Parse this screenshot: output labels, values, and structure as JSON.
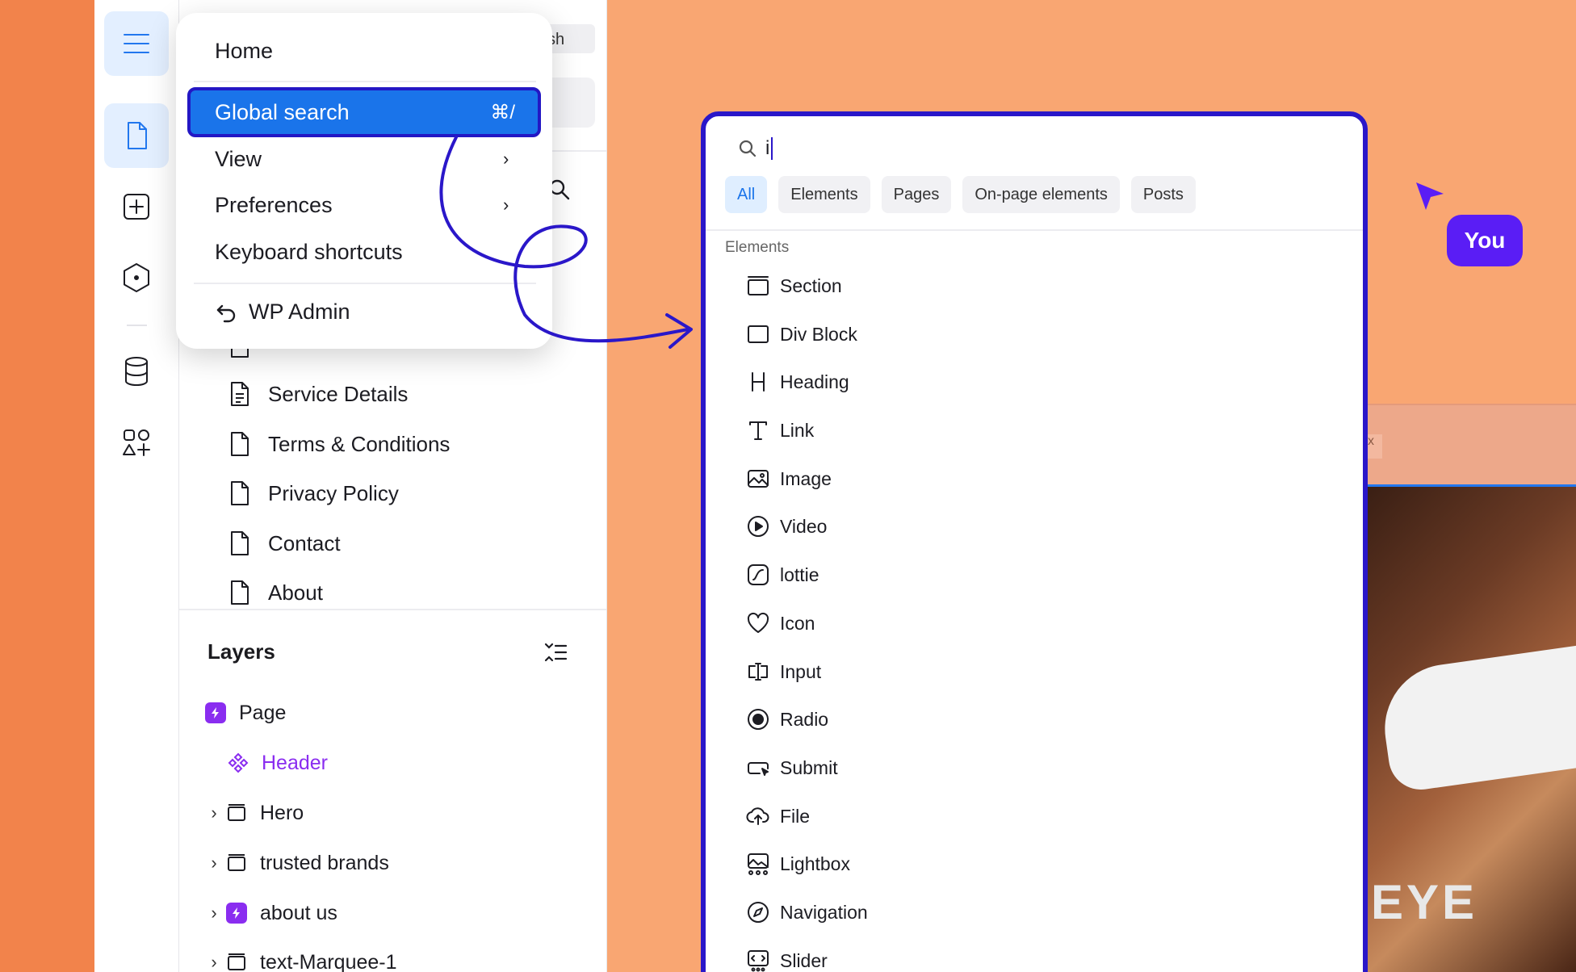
{
  "menu": {
    "home": "Home",
    "global_search": "Global search",
    "global_search_shortcut": "⌘/",
    "view": "View",
    "preferences": "Preferences",
    "keyboard_shortcuts": "Keyboard shortcuts",
    "wp_admin": "WP Admin"
  },
  "panel": {
    "top_chip": "sh",
    "pages": [
      {
        "label": "Service Details"
      },
      {
        "label": "Terms & Conditions"
      },
      {
        "label": "Privacy Policy"
      },
      {
        "label": "Contact"
      },
      {
        "label": "About"
      }
    ],
    "layers_title": "Layers",
    "layers": [
      {
        "label": "Page"
      },
      {
        "label": "Header"
      },
      {
        "label": "Hero"
      },
      {
        "label": "trusted brands"
      },
      {
        "label": "about us"
      },
      {
        "label": "text-Marquee-1"
      }
    ]
  },
  "search": {
    "query": "i",
    "tabs": [
      {
        "label": "All"
      },
      {
        "label": "Elements"
      },
      {
        "label": "Pages"
      },
      {
        "label": "On-page elements"
      },
      {
        "label": "Posts"
      }
    ],
    "section_label": "Elements",
    "items": [
      {
        "label": "Section",
        "icon": "section-icon"
      },
      {
        "label": "Div Block",
        "icon": "div-block-icon"
      },
      {
        "label": "Heading",
        "icon": "heading-icon"
      },
      {
        "label": "Link",
        "icon": "link-icon"
      },
      {
        "label": "Image",
        "icon": "image-icon"
      },
      {
        "label": "Video",
        "icon": "video-icon"
      },
      {
        "label": "lottie",
        "icon": "lottie-icon"
      },
      {
        "label": "Icon",
        "icon": "heart-icon"
      },
      {
        "label": "Input",
        "icon": "input-icon"
      },
      {
        "label": "Radio",
        "icon": "radio-icon"
      },
      {
        "label": "Submit",
        "icon": "submit-icon"
      },
      {
        "label": "File",
        "icon": "file-upload-icon"
      },
      {
        "label": "Lightbox",
        "icon": "lightbox-icon"
      },
      {
        "label": "Navigation",
        "icon": "navigation-icon"
      },
      {
        "label": "Slider",
        "icon": "slider-icon"
      }
    ]
  },
  "canvas": {
    "close_glyph": "x",
    "photo_text": "EYE"
  },
  "cursor": {
    "user_label": "You"
  },
  "colors": {
    "accent": "#1a74ea",
    "highlight_border": "#2a17c9",
    "component_purple": "#8a2df0",
    "you_badge": "#5a1df5",
    "background": "#f9a672"
  }
}
